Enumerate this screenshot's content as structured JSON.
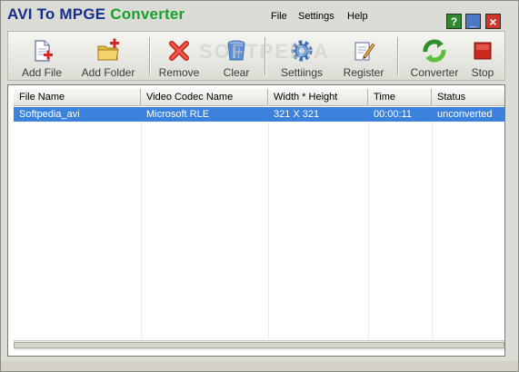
{
  "app": {
    "title_part1": "AVI To MPGE",
    "title_part2": "Converter"
  },
  "menu": [
    "File",
    "Settings",
    "Help"
  ],
  "window_buttons": {
    "help": "?",
    "minimize": "_",
    "close": "×"
  },
  "toolbar": {
    "add_file": "Add File",
    "add_folder": "Add Folder",
    "remove": "Remove",
    "clear": "Clear",
    "settings": "Settiings",
    "register": "Register",
    "converter": "Converter",
    "stop": "Stop"
  },
  "watermark": "SOFTPEDIA",
  "table": {
    "columns": [
      "File Name",
      "Video Codec Name",
      "Width * Height",
      "Time",
      "Status"
    ],
    "rows": [
      [
        "Softpedia_avi",
        "Microsoft RLE",
        "321 X 321",
        "00:00:11",
        "unconverted"
      ]
    ]
  },
  "colors": {
    "title_blue": "#15308a",
    "title_green": "#17a128",
    "selection": "#3c81dc"
  }
}
